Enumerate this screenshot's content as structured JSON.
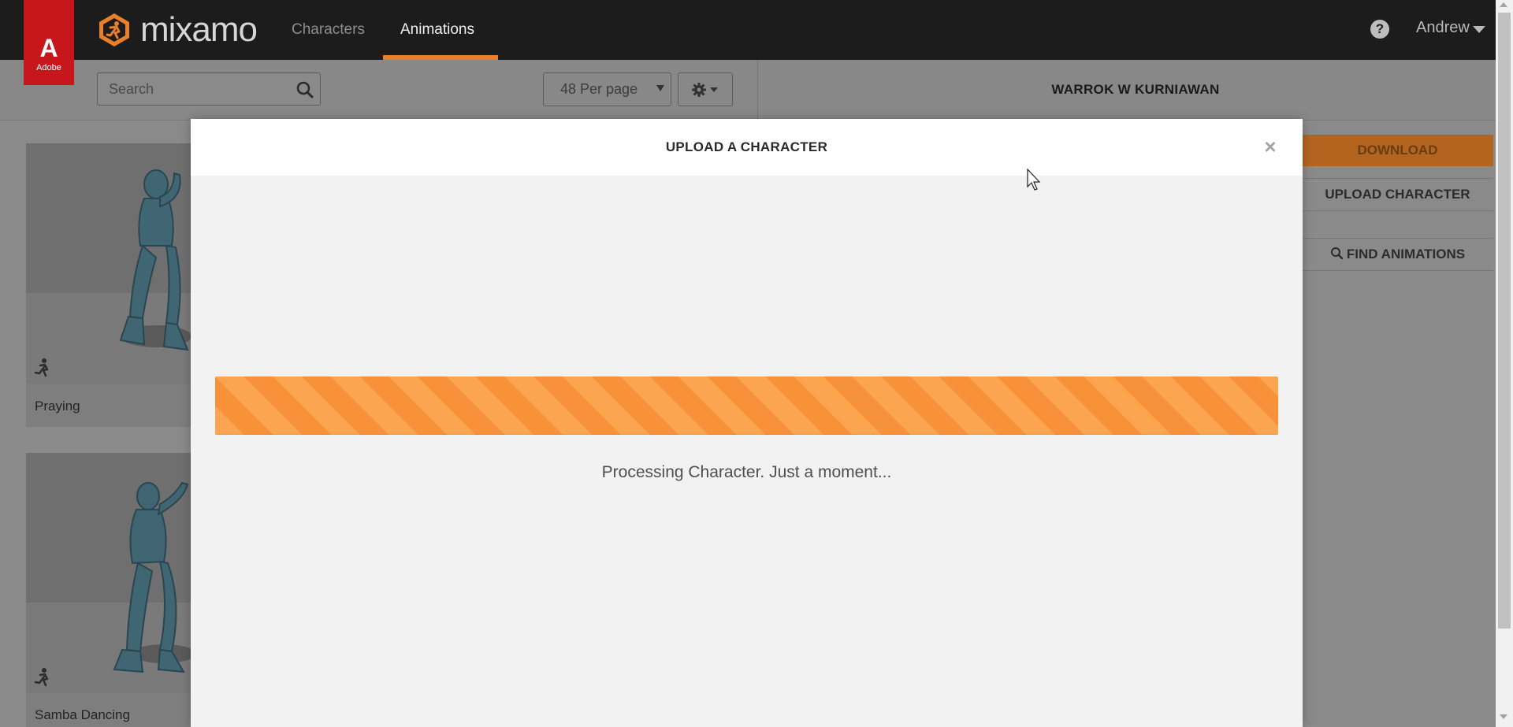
{
  "header": {
    "adobe_logo_text": "Adobe",
    "brand": "mixamo",
    "nav": [
      {
        "label": "Characters",
        "active": false
      },
      {
        "label": "Animations",
        "active": true
      }
    ],
    "help_icon": "question-circle-icon",
    "user_name": "Andrew",
    "accent_color": "#e8802b"
  },
  "toolbar": {
    "search_placeholder": "Search",
    "search_value": "",
    "per_page": "48 Per page",
    "settings_icon": "gear-icon"
  },
  "character": {
    "name": "WARROK W KURNIAWAN"
  },
  "cards": [
    {
      "label": "Praying",
      "icon": "running-figure-icon"
    },
    {
      "label": "Samba Dancing",
      "icon": "running-figure-icon"
    }
  ],
  "right_panel": {
    "download_label": "DOWNLOAD",
    "upload_label": "UPLOAD CHARACTER",
    "find_label": "FIND ANIMATIONS"
  },
  "modal": {
    "title": "UPLOAD A CHARACTER",
    "close_icon": "close-icon",
    "status_text": "Processing Character. Just a moment...",
    "progress_fraction": 1.0,
    "progress_color": "#fba550"
  }
}
